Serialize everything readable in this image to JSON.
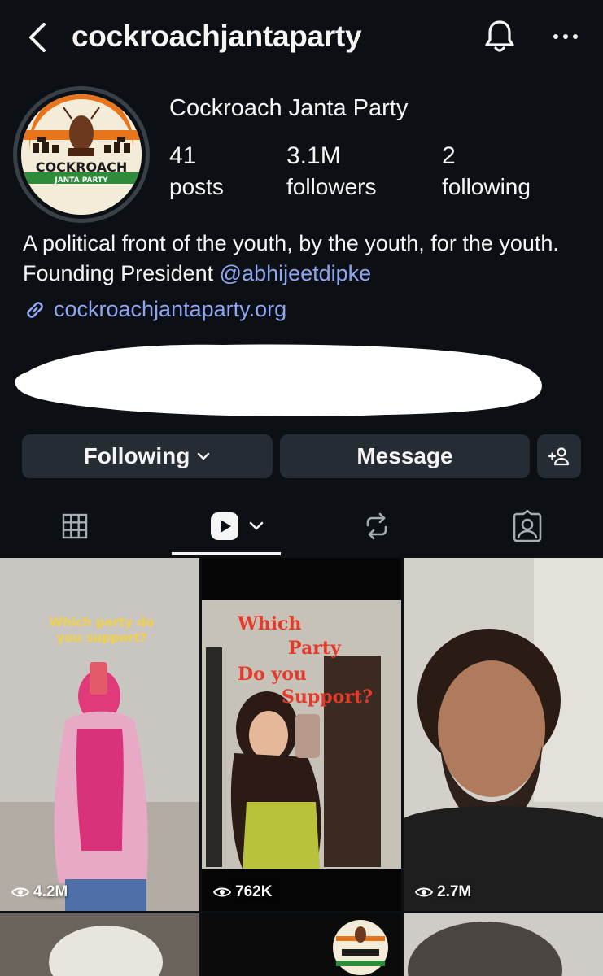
{
  "header": {
    "username": "cockroachjantaparty",
    "icons": [
      "back-chevron-icon",
      "bell-icon",
      "more-options-icon"
    ]
  },
  "profile": {
    "display_name": "Cockroach Janta Party",
    "avatar_logo": {
      "line1": "COCKROACH",
      "line2": "JANTA PARTY"
    },
    "stats": [
      {
        "value": "41",
        "label": "posts"
      },
      {
        "value": "3.1M",
        "label": "followers"
      },
      {
        "value": "2",
        "label": "following"
      }
    ],
    "bio_text": "A political front of the youth, by the youth, for the youth. Founding President ",
    "bio_mention": "@abhijeetdipke",
    "link": "cockroachjantaparty.org"
  },
  "actions": {
    "following_label": "Following",
    "message_label": "Message"
  },
  "tabs": {
    "active": "reels",
    "icons": [
      "grid-icon",
      "reels-icon",
      "reposts-icon",
      "tagged-icon"
    ]
  },
  "reels": [
    {
      "views": "4.2M",
      "caption": "Which party do you support?"
    },
    {
      "views": "762K",
      "caption_lines": [
        "Which",
        "Party",
        "Do you",
        "Support?"
      ]
    },
    {
      "views": "2.7M"
    }
  ],
  "colors": {
    "background": "#0c1014",
    "button": "#262c33",
    "link": "#8fa7f3",
    "text": "#f5f5f5"
  }
}
